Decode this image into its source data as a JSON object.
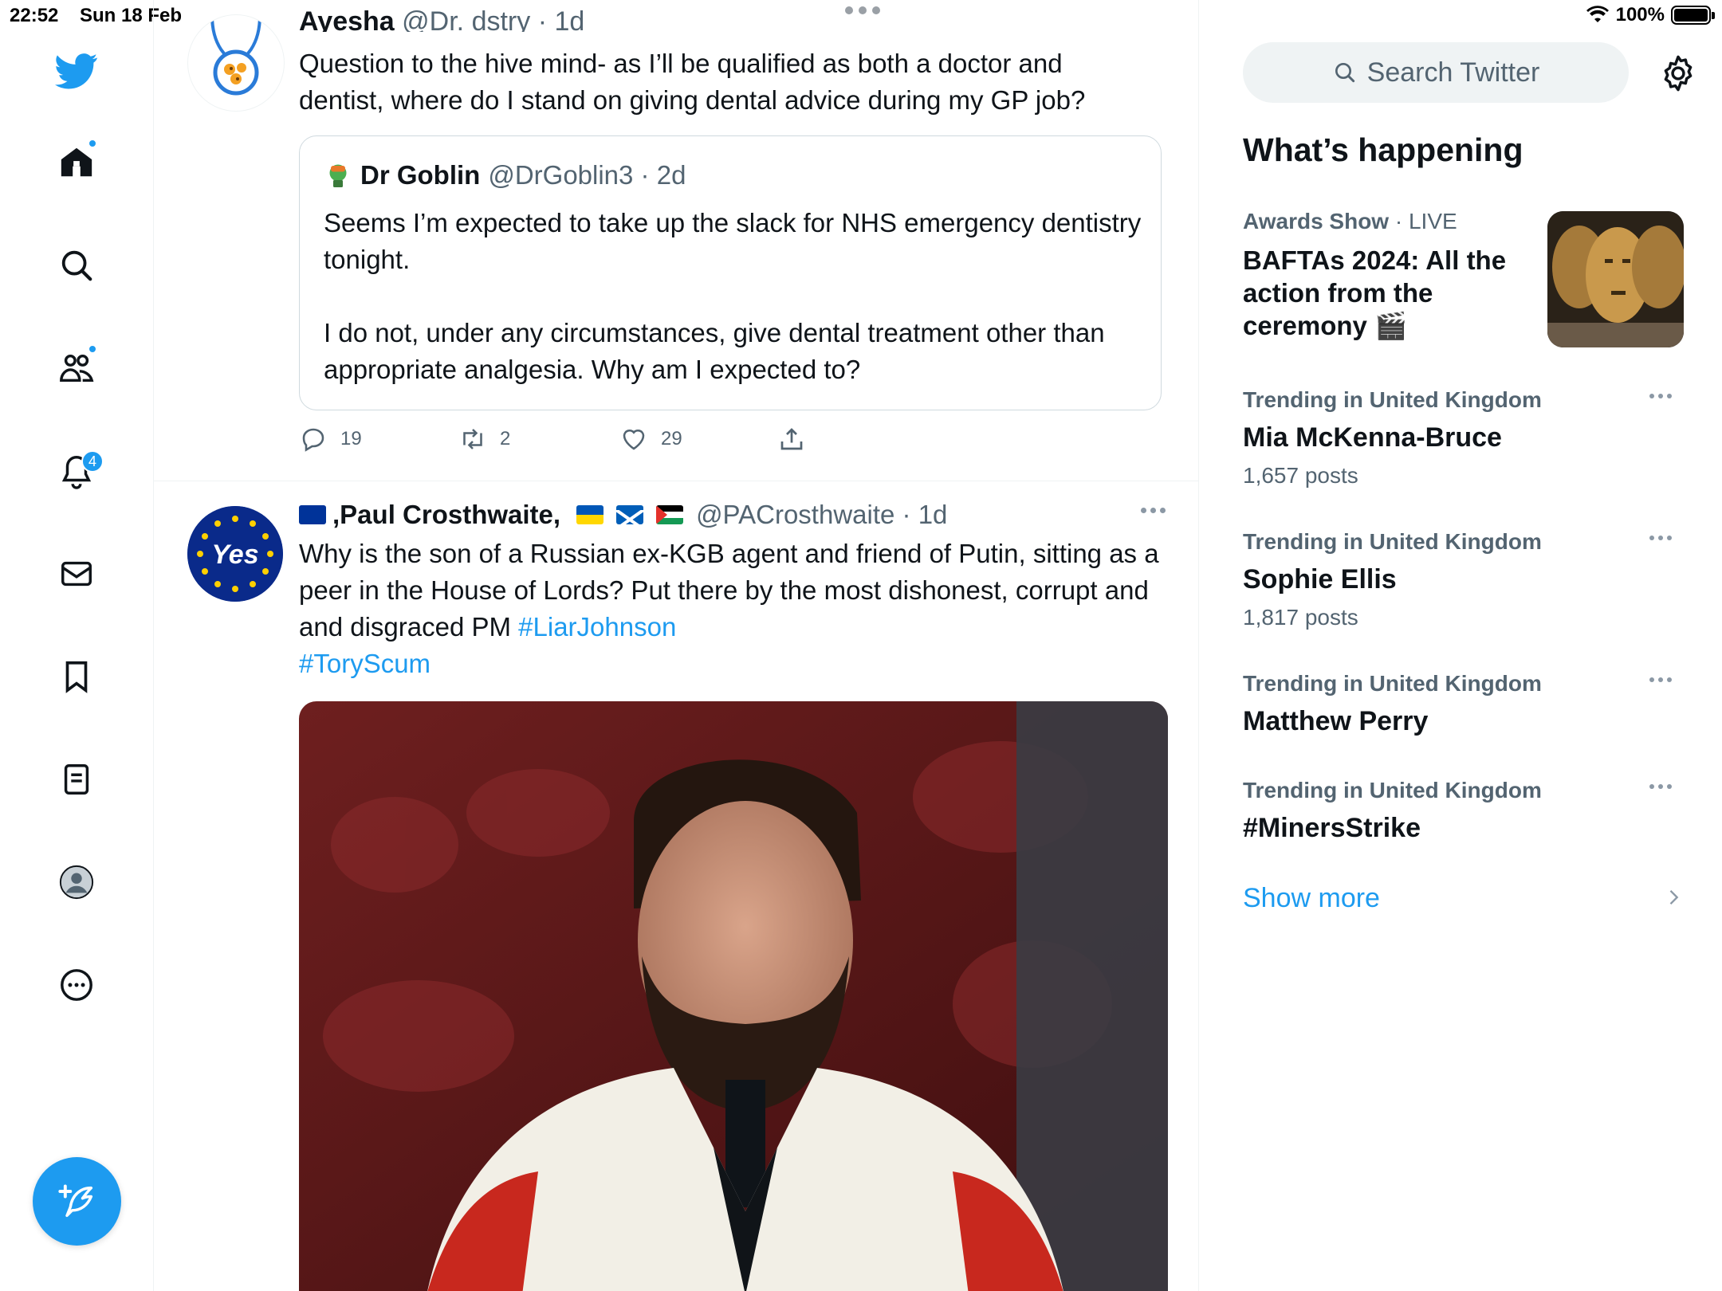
{
  "status_bar": {
    "time": "22:52",
    "date": "Sun 18 Feb",
    "battery": "100%",
    "battery_level": 1.0
  },
  "nav": {
    "items": [
      "twitter-logo",
      "home",
      "explore",
      "communities",
      "notifications",
      "messages",
      "bookmarks",
      "lists",
      "profile",
      "more"
    ],
    "notifications_count": "4"
  },
  "tweet1": {
    "cut_header_name": "Ayesha",
    "cut_header_handle": "@Dr. dstry · 1d",
    "text": "Question to the hive mind- as I’ll be qualified as both a doctor and dentist, where do I stand on giving dental advice during my GP job?",
    "quote": {
      "name": "Dr Goblin",
      "handle_time": "@DrGoblin3 · 2d",
      "paragraph1": "Seems I’m expected to take up the slack for NHS emergency dentistry tonight.",
      "paragraph2": "I do not, under any circumstances, give dental treatment other than appropriate analgesia. Why am I expected to?"
    },
    "replies": "19",
    "retweets": "2",
    "likes": "29"
  },
  "tweet2": {
    "name_prefix": ",Paul Crosthwaite,",
    "handle_time": "@PACrosthwaite · 1d",
    "text": "Why is the son of a Russian ex-KGB agent and friend of Putin, sitting as a peer in the House of Lords?   Put there by the most dishonest, corrupt and and disgraced PM ",
    "hashtag1": "#LiarJohnson",
    "hashtag2": "#ToryScum",
    "avatar_text": "Yes"
  },
  "sidebar": {
    "search_placeholder": "Search Twitter",
    "whats_happening": "What’s happening",
    "event": {
      "category": "Awards Show",
      "status": "· LIVE",
      "title": "BAFTAs 2024: All the action from the ceremony 🎬"
    },
    "trends": [
      {
        "context": "Trending in United Kingdom",
        "name": "Mia McKenna-Bruce",
        "posts": "1,657 posts"
      },
      {
        "context": "Trending in United Kingdom",
        "name": "Sophie Ellis",
        "posts": "1,817 posts"
      },
      {
        "context": "Trending in United Kingdom",
        "name": "Matthew Perry",
        "posts": ""
      },
      {
        "context": "Trending in United Kingdom",
        "name": "#MinersStrike",
        "posts": ""
      }
    ],
    "show_more": "Show more"
  },
  "colors": {
    "accent": "#1d9bf0",
    "text": "#0f1419",
    "secondary": "#536471",
    "border": "#eff3f4"
  }
}
